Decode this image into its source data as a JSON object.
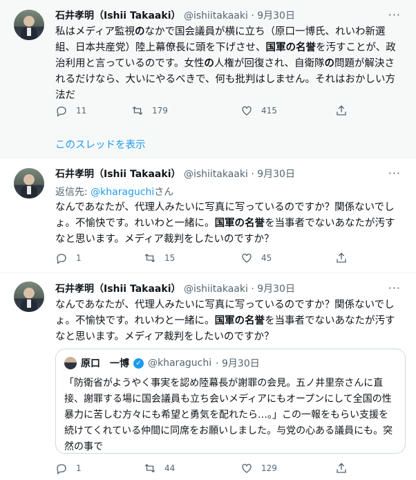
{
  "tweets": [
    {
      "name": "石井孝明（Ishii Takaaki）",
      "handle": "@ishiitakaaki",
      "date": "· 9月30日",
      "body_html": "私はメディア監視<b>の</b>なかで国会議員が横に立ち（原口一博氏、れいわ新選組、日本共産党）陸上幕僚長に頭を下げさせ、<b>国軍の名誉</b>を汚すことが、政治利用と言っているのです。女性<b>の</b>人権が回復され、自衛隊<b>の</b>問題が解決されるだけなら、大いにやるべきで、何も批判はしません。それはおかしい方法だ",
      "reply_count": "11",
      "retweet_count": "179",
      "like_count": "415",
      "show_thread": "このスレッドを表示"
    },
    {
      "name": "石井孝明（Ishii Takaaki）",
      "handle": "@ishiitakaaki",
      "date": "· 9月30日",
      "reply_prefix": "返信先: ",
      "reply_handle": "@kharaguchi",
      "reply_suffix": "さん",
      "body_html": "なんであなたが、代理人みたいに写真に写っているのですか？関係ないでしょ。不愉快です。れいわと一緒に。<b>国軍の名誉</b>を当事者でないあなたが汚すなと思います。メディア裁判をしたいのですか？",
      "reply_count": "1",
      "retweet_count": "15",
      "like_count": "45"
    },
    {
      "name": "石井孝明（Ishii Takaaki）",
      "handle": "@ishiitakaaki",
      "date": "· 9月30日",
      "body_html": "なんであなたが、代理人みたいに写真に写っているのですか？関係ないでしょ。不愉快です。れいわと一緒に。<b>国軍の名誉</b>を当事者でないあなたが汚すなと思います。メディア裁判をしたいのですか？",
      "reply_count": "1",
      "retweet_count": "44",
      "like_count": "129",
      "quote": {
        "name": "原口　一博",
        "handle": "@kharaguchi",
        "date": "· 9月30日",
        "body": "「防衛省がようやく事実を認め陸幕長が謝罪の会見。五ノ井里奈さんに直接、謝罪する場に国会議員も立ち会いメディアにもオープンにして全国の性暴力に苦しむ方々にも希望と勇気を配れたら…。」この一報をもらい支援を続けてくれている仲間に同席をお願いしました。与党の心ある議員にも。突然の事で"
      }
    }
  ],
  "icons": {
    "reply": "reply-icon",
    "retweet": "retweet-icon",
    "like": "heart-icon",
    "share": "share-icon",
    "more": "more-icon",
    "verified": "verified-badge-icon"
  },
  "colors": {
    "accent": "#1d9bf0",
    "muted": "#536471",
    "text": "#0f1419",
    "highlight_bg": "#f7f9f9"
  },
  "more_label": "···"
}
